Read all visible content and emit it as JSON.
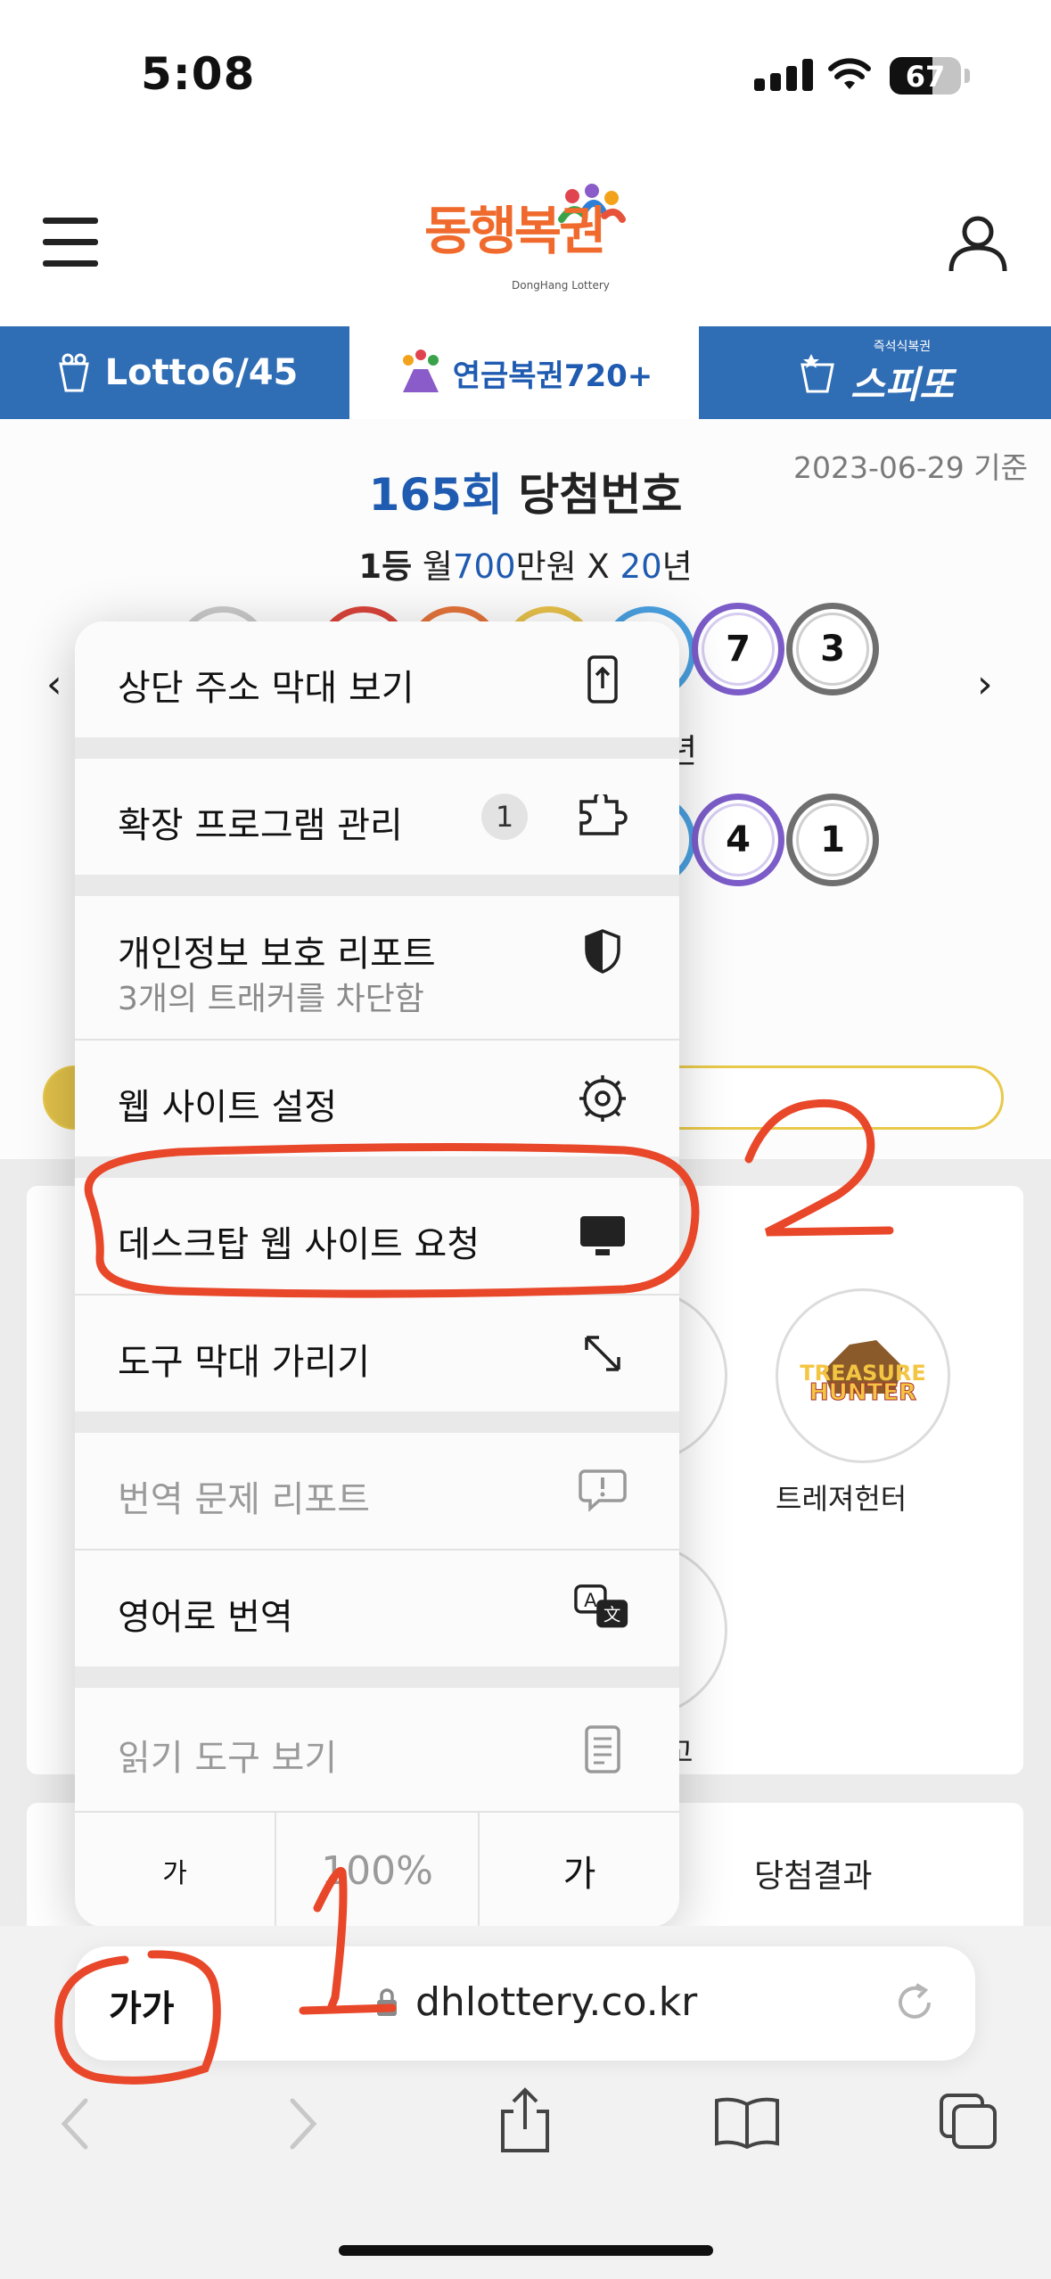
{
  "status_bar": {
    "time": "5:08",
    "battery": "67"
  },
  "header": {
    "logo_text": "동행복권",
    "logo_sub": "DongHang Lottery"
  },
  "tabs": [
    {
      "label": "Lotto6/45"
    },
    {
      "label": "연금복권720+"
    },
    {
      "label": "스피또",
      "sublabel": "즉석식복권"
    }
  ],
  "draw": {
    "date_note": "2023-06-29 기준",
    "round": "165회",
    "round_suffix": "당첨번호",
    "prize_rank": "1등",
    "prize_text_1": "월",
    "prize_amount": "700",
    "prize_text_2": "만원 X",
    "prize_years": "20",
    "prize_text_3": "년",
    "row1_balls": [
      "7",
      "3"
    ],
    "row2_partial": "년",
    "row2_balls": [
      "4",
      "1"
    ]
  },
  "games": {
    "featured_name": "트레져헌터",
    "partial_label": "고"
  },
  "bottom_tabs": {
    "results": "당첨결과"
  },
  "menu": {
    "items": [
      {
        "label": "상단 주소 막대 보기"
      },
      {
        "label": "확장 프로그램 관리",
        "badge": "1"
      },
      {
        "label": "개인정보 보호 리포트",
        "sub": "3개의 트래커를 차단함"
      },
      {
        "label": "웹 사이트 설정"
      },
      {
        "label": "데스크탑 웹 사이트 요청"
      },
      {
        "label": "도구 막대 가리기"
      },
      {
        "label": "번역 문제 리포트"
      },
      {
        "label": "영어로 번역"
      },
      {
        "label": "읽기 도구 보기"
      }
    ],
    "zoom": {
      "smaller": "가",
      "level": "100%",
      "larger": "가"
    }
  },
  "address_bar": {
    "aa_label": "가가",
    "url": "dhlottery.co.kr"
  },
  "annotations": {
    "mark_1": "1",
    "mark_2": "2",
    "color": "#e8472a"
  }
}
